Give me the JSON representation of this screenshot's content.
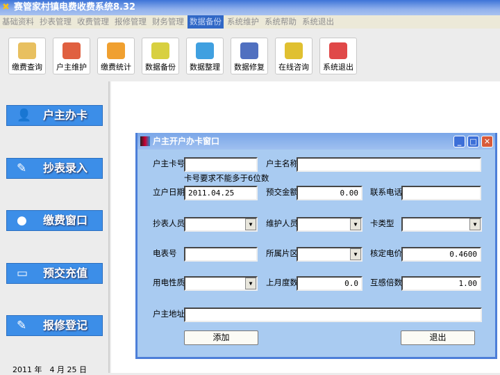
{
  "app": {
    "title": "赛管家村镇电费收费系统8.32"
  },
  "menu": [
    "基础资料",
    "抄表管理",
    "收费管理",
    "报修管理",
    "财务管理",
    "数据备份",
    "系统维护",
    "系统帮助",
    "系统退出"
  ],
  "toolbar": [
    {
      "label": "缴费查询",
      "icon": "search-folder-icon",
      "color": "#e8c060"
    },
    {
      "label": "户主维护",
      "icon": "users-icon",
      "color": "#e06040"
    },
    {
      "label": "缴费统计",
      "icon": "statistics-box-icon",
      "color": "#f0a030"
    },
    {
      "label": "数据备份",
      "icon": "disc-backup-icon",
      "color": "#d8d040"
    },
    {
      "label": "数据整理",
      "icon": "pie-chart-icon",
      "color": "#40a0e0"
    },
    {
      "label": "数据修复",
      "icon": "floppy-wrench-icon",
      "color": "#5070c0"
    },
    {
      "label": "在线咨询",
      "icon": "online-help-icon",
      "color": "#e0c030"
    },
    {
      "label": "系统退出",
      "icon": "power-icon",
      "color": "#e04848"
    }
  ],
  "sidebar": [
    {
      "label": "户主办卡",
      "icon": "user-card-icon",
      "glyph": "👤"
    },
    {
      "label": "抄表录入",
      "icon": "notebook-pen-icon",
      "glyph": "✎"
    },
    {
      "label": "缴费窗口",
      "icon": "coins-icon",
      "glyph": "●"
    },
    {
      "label": "预交充值",
      "icon": "card-book-icon",
      "glyph": "▭"
    },
    {
      "label": "报修登记",
      "icon": "notebook-pen-icon",
      "glyph": "✎"
    }
  ],
  "date": "2011 年　4 月 25 日",
  "dialog": {
    "title": "户主开户办卡窗口",
    "fields": {
      "card_no": {
        "label": "户主卡号",
        "value": ""
      },
      "card_hint": "卡号要求不能多于6位数",
      "owner_name": {
        "label": "户主名称",
        "value": ""
      },
      "open_date": {
        "label": "立户日期",
        "value": "2011.04.25"
      },
      "prepay": {
        "label": "预交金额",
        "value": "0.00"
      },
      "phone": {
        "label": "联系电话",
        "value": ""
      },
      "reader": {
        "label": "抄表人员",
        "value": ""
      },
      "maintainer": {
        "label": "维护人员",
        "value": ""
      },
      "card_type": {
        "label": "卡类型",
        "value": ""
      },
      "meter_no": {
        "label": "电表号",
        "value": ""
      },
      "area": {
        "label": "所属片区",
        "value": ""
      },
      "price": {
        "label": "核定电价",
        "value": "0.4600"
      },
      "usage_type": {
        "label": "用电性质",
        "value": ""
      },
      "last_reading": {
        "label": "上月度数",
        "value": "0.0"
      },
      "ct_ratio": {
        "label": "互感倍数",
        "value": "1.00"
      },
      "address": {
        "label": "户主地址",
        "value": ""
      }
    },
    "add_label": "添加",
    "exit_label": "退出"
  }
}
